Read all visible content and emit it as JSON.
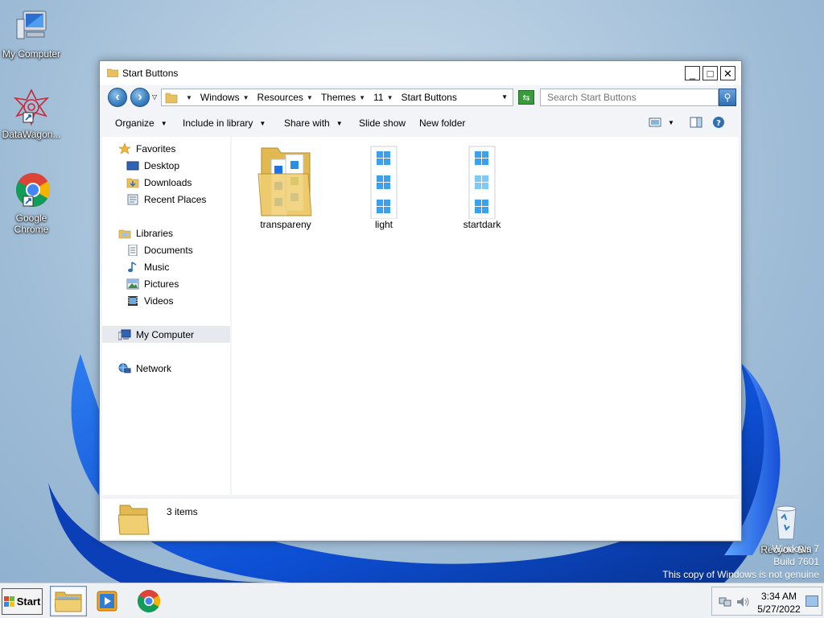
{
  "desktop": {
    "icons": [
      {
        "label": "My Computer",
        "icon": "my-computer-icon"
      },
      {
        "label": "DataWagon...",
        "icon": "datawagon-icon"
      },
      {
        "label": "Google Chrome",
        "icon": "chrome-icon"
      },
      {
        "label": "Recycle Bin",
        "icon": "recycle-bin-icon"
      }
    ],
    "watermark": {
      "line1": "Windows 7",
      "line2": "Build 7601",
      "line3": "This copy of Windows is not genuine"
    }
  },
  "window": {
    "title": "Start Buttons",
    "controls": {
      "minimize": "_",
      "maximize": "□",
      "close": "✕"
    },
    "breadcrumb": [
      "Windows",
      "Resources",
      "Themes",
      "11",
      "Start Buttons"
    ],
    "search": {
      "placeholder": "Search Start Buttons"
    },
    "toolbar": {
      "organize": "Organize",
      "include": "Include in library",
      "share": "Share with",
      "slideshow": "Slide show",
      "newfolder": "New folder"
    },
    "nav": {
      "favorites": "Favorites",
      "desktop": "Desktop",
      "downloads": "Downloads",
      "recent": "Recent Places",
      "libraries": "Libraries",
      "documents": "Documents",
      "music": "Music",
      "pictures": "Pictures",
      "videos": "Videos",
      "computer": "My Computer",
      "network": "Network"
    },
    "files": [
      {
        "name": "transpareny",
        "type": "folder"
      },
      {
        "name": "light",
        "type": "image"
      },
      {
        "name": "startdark",
        "type": "image"
      }
    ],
    "status": {
      "count": "3 items"
    }
  },
  "taskbar": {
    "start": "Start",
    "time": "3:34 AM",
    "date": "5/27/2022"
  },
  "colors": {
    "accent": "#3c82c4",
    "win_blue": "#1a73e8"
  }
}
